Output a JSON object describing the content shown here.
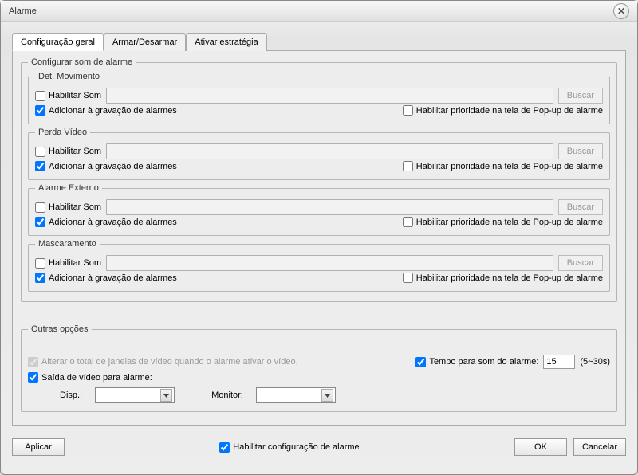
{
  "window": {
    "title": "Alarme"
  },
  "tabs": {
    "general": "Configuração geral",
    "arm": "Armar/Desarmar",
    "strategy": "Ativar estratégia"
  },
  "soundGroup": {
    "legend": "Configurar som de alarme",
    "enableSound": "Habilitar Som",
    "search": "Buscar",
    "addRecord": "Adicionar à gravação de alarmes",
    "popupPriority": "Habilitar prioridade na tela de Pop-up de alarme",
    "sections": {
      "motion": "Det. Movimento",
      "videoLoss": "Perda Vídeo",
      "external": "Alarme Externo",
      "masking": "Mascaramento"
    }
  },
  "other": {
    "legend": "Outras opções",
    "changeWindows": "Alterar o total de janelas de vídeo quando o alarme ativar o vídeo.",
    "timeForSound": "Tempo para som do alarme:",
    "timeValue": "15",
    "timeRange": "(5~30s)",
    "videoOut": "Saída de vídeo para alarme:",
    "dispLabel": "Disp.:",
    "monitorLabel": "Monitor:"
  },
  "buttons": {
    "apply": "Aplicar",
    "ok": "OK",
    "cancel": "Cancelar"
  },
  "footerCheck": "Habilitar configuração de alarme"
}
